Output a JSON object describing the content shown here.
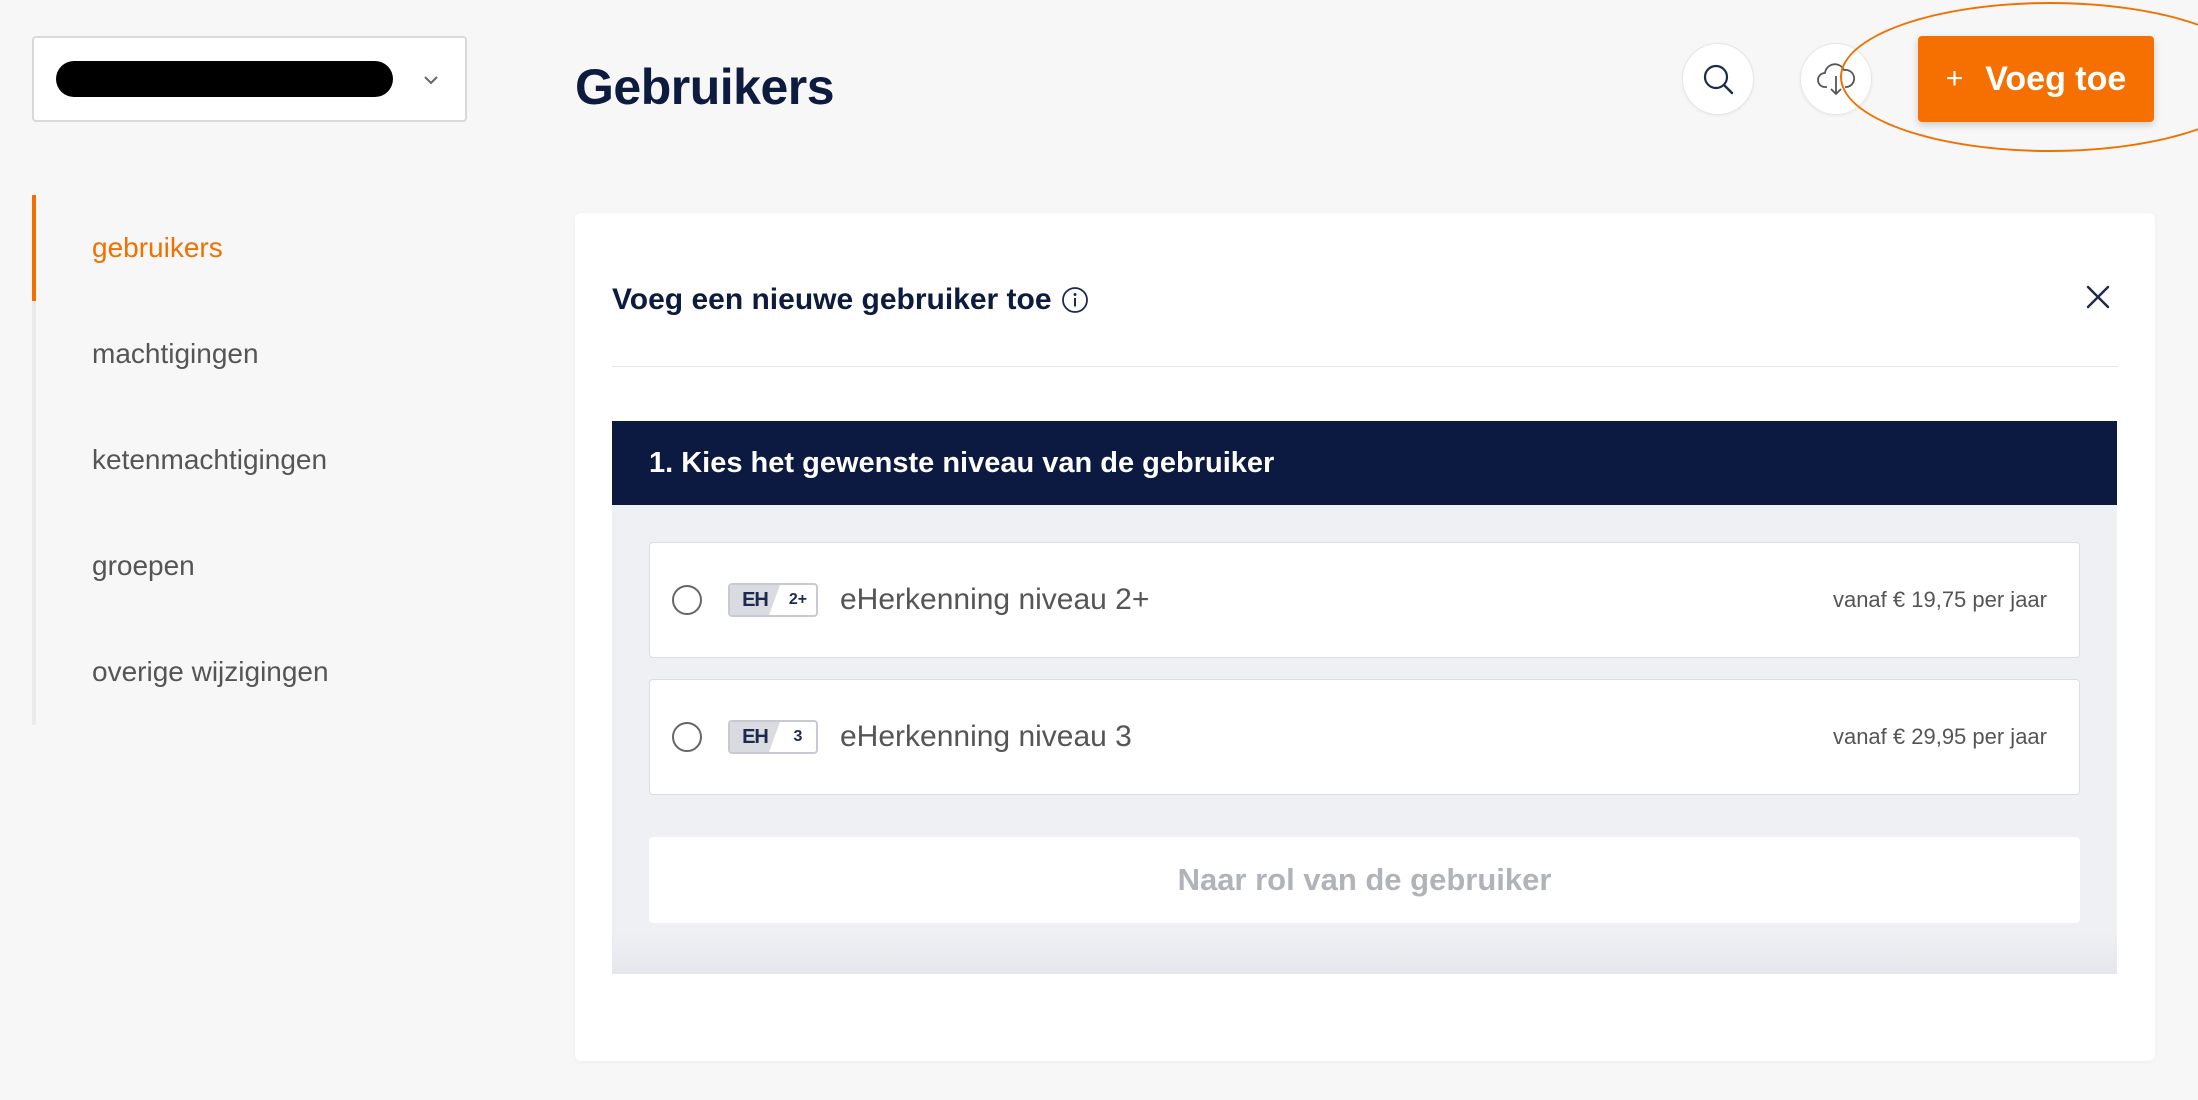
{
  "org_selector": {
    "value": ""
  },
  "sidebar": {
    "items": [
      {
        "label": "gebruikers",
        "active": true
      },
      {
        "label": "machtigingen",
        "active": false
      },
      {
        "label": "ketenmachtigingen",
        "active": false
      },
      {
        "label": "groepen",
        "active": false
      },
      {
        "label": "overige wijzigingen",
        "active": false
      }
    ]
  },
  "header": {
    "title": "Gebruikers",
    "add_button_label": "Voeg toe",
    "add_button_icon": "+"
  },
  "panel": {
    "title": "Voeg een nieuwe gebruiker toe",
    "step_title": "1. Kies het gewenste niveau van de gebruiker",
    "options": [
      {
        "badge_text": "EH",
        "badge_level": "2+",
        "label": "eHerkenning niveau 2+",
        "price": "vanaf € 19,75 per jaar"
      },
      {
        "badge_text": "EH",
        "badge_level": "3",
        "label": "eHerkenning niveau 3",
        "price": "vanaf € 29,95 per jaar"
      }
    ],
    "next_button_label": "Naar rol van de gebruiker"
  },
  "colors": {
    "accent": "#f57000",
    "navy": "#0c1a42",
    "background": "#f7f7f7"
  }
}
